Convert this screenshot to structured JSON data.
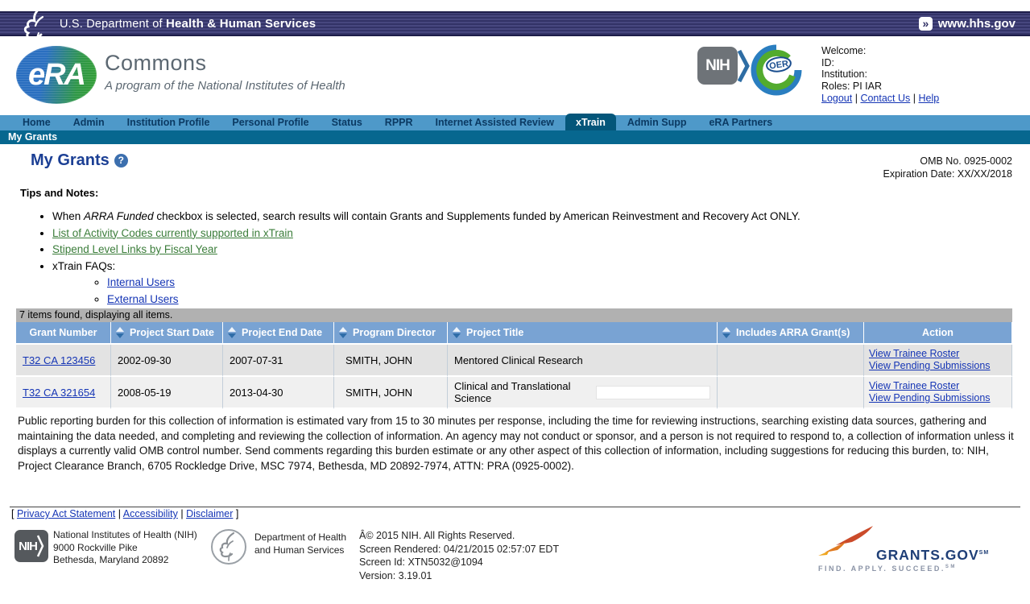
{
  "banner": {
    "dept_prefix": "U.S. Department of ",
    "dept_bold": "Health & Human Services",
    "chevrons": "»",
    "site": "www.hhs.gov"
  },
  "logo": {
    "era": "eRA",
    "commons": "Commons",
    "tagline": "A program of the National Institutes of Health",
    "nih": "NIH",
    "oer": "OER"
  },
  "user": {
    "welcome": "Welcome:",
    "id": "ID:",
    "institution": "Institution:",
    "roles": "Roles:  PI  IAR",
    "links": [
      "Logout",
      "Contact Us",
      "Help"
    ],
    "sep": "|"
  },
  "nav": {
    "items": [
      "Home",
      "Admin",
      "Institution Profile",
      "Personal Profile",
      "Status",
      "RPPR",
      "Internet Assisted Review",
      "xTrain",
      "Admin Supp",
      "eRA Partners"
    ],
    "subnav": "My Grants"
  },
  "page": {
    "title": "My Grants",
    "help": "?",
    "omb_line1": "OMB No. 0925-0002",
    "omb_line2": "Expiration Date: XX/XX/2018"
  },
  "tips": {
    "heading": "Tips and Notes:",
    "bullet1_pre": "When ",
    "bullet1_italic": "ARRA Funded",
    "bullet1_post": " checkbox is selected, search results will contain Grants and Supplements funded by American Reinvestment and Recovery Act ONLY.",
    "link1": "List of Activity Codes currently supported in xTrain",
    "link2": "Stipend Level Links by Fiscal Year",
    "faq_label": "xTrain FAQs:",
    "faq_link1": "Internal Users",
    "faq_link2": "External Users"
  },
  "table": {
    "summary": "7 items found, displaying all items.",
    "columns": [
      "Grant Number",
      "Project Start Date",
      "Project End Date",
      "Program Director",
      "Project Title",
      "Includes ARRA Grant(s)",
      "Action"
    ],
    "rows": [
      {
        "grant": "T32 CA 123456",
        "start": "2002-09-30",
        "end": "2007-07-31",
        "director": "SMITH, JOHN",
        "title": "Mentored Clinical Research",
        "arra": "",
        "action1": "View Trainee Roster",
        "action2": "View Pending Submissions"
      },
      {
        "grant": "T32 CA 321654",
        "start": "2008-05-19",
        "end": "2013-04-30",
        "director": "SMITH, JOHN",
        "title": "Clinical and Translational Science",
        "arra": "",
        "action1": "View Trainee Roster",
        "action2": "View Pending Submissions"
      }
    ]
  },
  "burden": "Public reporting burden for this collection of information is estimated vary from 15 to 30 minutes per response, including the time for reviewing instructions, searching existing data sources, gathering and maintaining the data needed, and completing and reviewing the collection of information.  An agency may not conduct or sponsor, and a person is not required to respond to, a collection of information unless it displays a currently valid OMB control number.  Send comments regarding this burden estimate or any other aspect of this collection of information, including suggestions for reducing this burden, to: NIH, Project Clearance Branch, 6705 Rockledge Drive, MSC 7974, Bethesda, MD 20892-7974, ATTN: PRA (0925-0002).",
  "footer": {
    "bracket_open": "[",
    "bracket_close": "]",
    "sep": "|",
    "link1": "Privacy Act Statement",
    "link2": "Accessibility",
    "link3": "Disclaimer",
    "nih_line1": "National Institutes of Health (NIH)",
    "nih_line2": "9000 Rockville Pike",
    "nih_line3": "Bethesda, Maryland 20892",
    "dept_line1": "Department of Health",
    "dept_line2": "and Human Services",
    "info1": "Â© 2015 NIH. All Rights Reserved.",
    "info2": "Screen Rendered: 04/21/2015 02:57:07 EDT",
    "info3": "Screen Id: XTN5032@1094",
    "info4": "Version: 3.19.01",
    "grants_gov": "GRANTS.GOV",
    "grants_sm": "SM",
    "grants_tag": "FIND. APPLY. SUCCEED.",
    "grants_tag_sm": "SM"
  },
  "colors": {
    "banner_navy": "#333367",
    "nav_blue": "#4e99c9",
    "active_tab": "#04567a",
    "subnav_teal": "#07678f",
    "table_header_blue": "#79a3d3",
    "row_gray": "#e3e3e3",
    "link_blue": "#1535b5",
    "link_green": "#3b7d3a",
    "title_navy": "#1b3f94"
  }
}
